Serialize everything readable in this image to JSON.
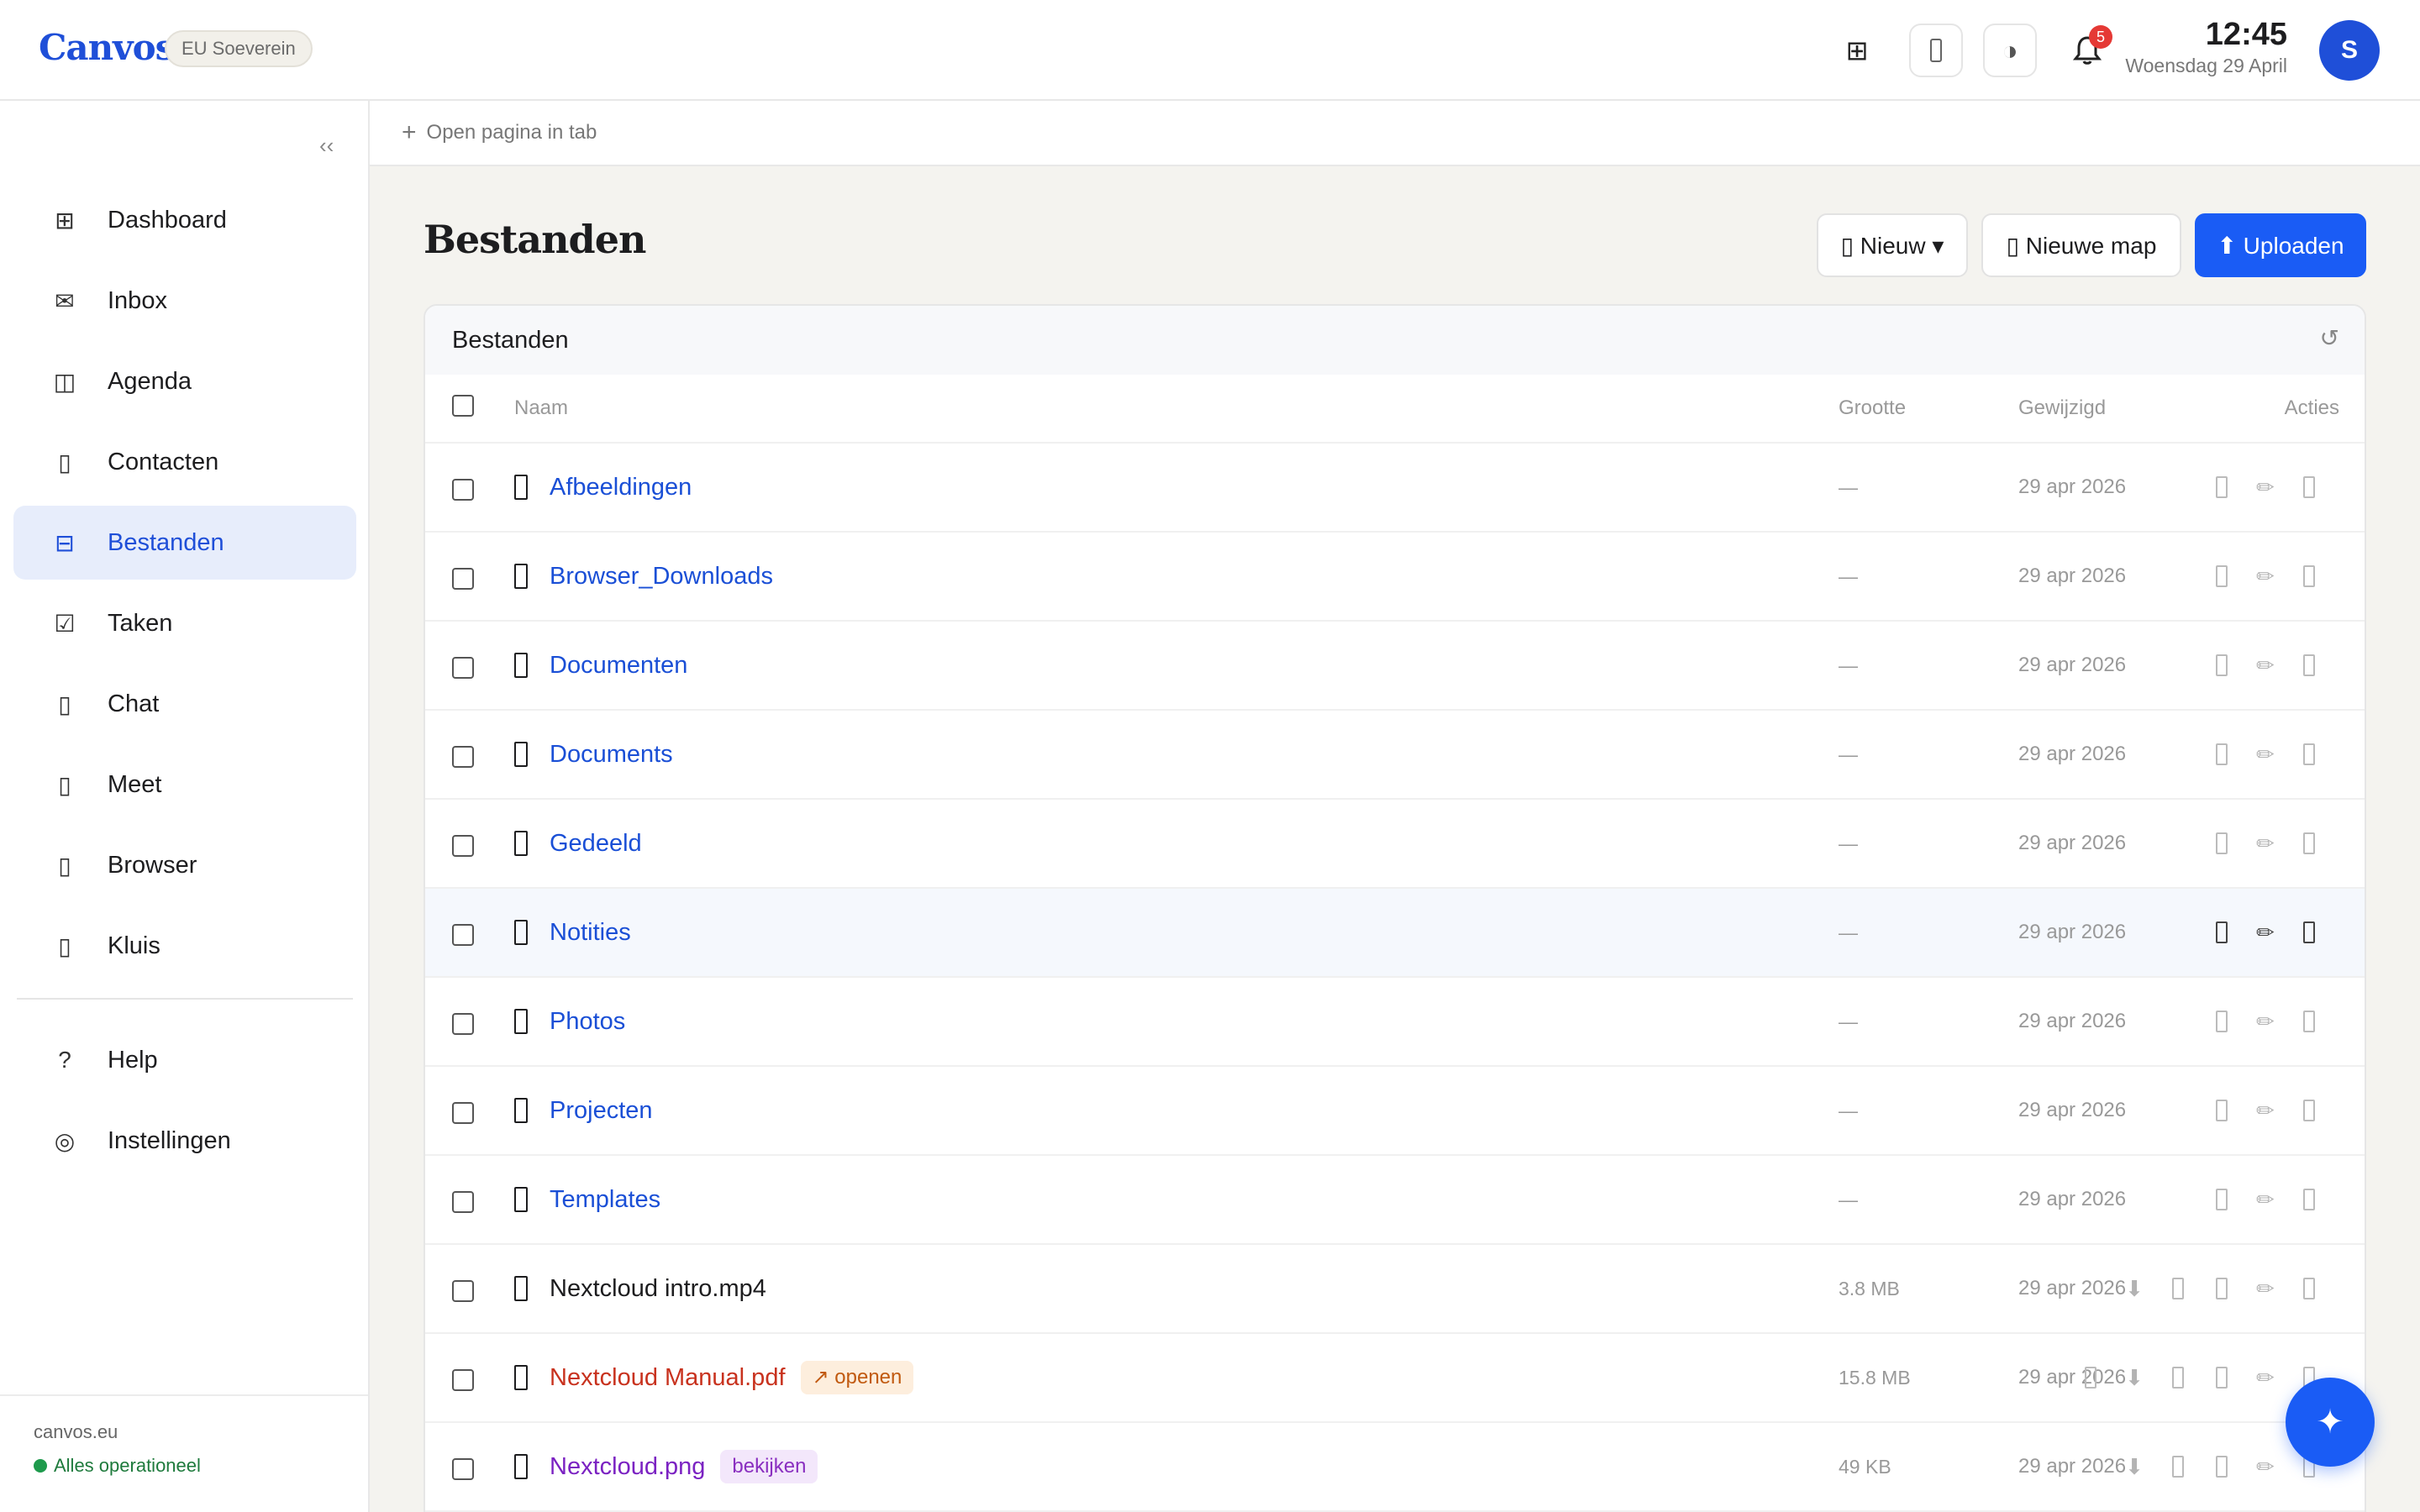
{
  "header": {
    "logo": "Canvos",
    "region_badge": "EU Soeverein",
    "notification_count": "5",
    "clock_time": "12:45",
    "clock_date": "Woensdag 29 April",
    "avatar_initial": "S",
    "icons": [
      "grid-icon",
      "phone-icon",
      "contrast-icon",
      "bell-icon"
    ]
  },
  "sidebar": {
    "collapse_label": "‹‹",
    "items": [
      {
        "label": "Dashboard",
        "icon": "⊞"
      },
      {
        "label": "Inbox",
        "icon": "✉"
      },
      {
        "label": "Agenda",
        "icon": "◫"
      },
      {
        "label": "Contacten",
        "icon": "▯"
      },
      {
        "label": "Bestanden",
        "icon": "⊟",
        "active": true
      },
      {
        "label": "Taken",
        "icon": "☑"
      },
      {
        "label": "Chat",
        "icon": "▯"
      },
      {
        "label": "Meet",
        "icon": "▯"
      },
      {
        "label": "Browser",
        "icon": "▯"
      },
      {
        "label": "Kluis",
        "icon": "▯"
      }
    ],
    "bottom_items": [
      {
        "label": "Help",
        "icon": "?"
      },
      {
        "label": "Instellingen",
        "icon": "◎"
      }
    ],
    "footer_domain": "canvos.eu",
    "footer_status": "Alles operationeel"
  },
  "tabstrip": {
    "open_tab_label": "Open pagina in tab"
  },
  "main": {
    "title": "Bestanden",
    "new_button": "▯ Nieuw ▾",
    "new_folder_button": "▯ Nieuwe map",
    "upload_button": "⬆ Uploaden",
    "panel_title": "Bestanden",
    "columns": {
      "name": "Naam",
      "size": "Grootte",
      "modified": "Gewijzigd",
      "actions": "Acties"
    },
    "rows": [
      {
        "name": "Afbeeldingen",
        "size": "—",
        "modified": "29 apr 2026",
        "kind": "folder"
      },
      {
        "name": "Browser_Downloads",
        "size": "—",
        "modified": "29 apr 2026",
        "kind": "folder"
      },
      {
        "name": "Documenten",
        "size": "—",
        "modified": "29 apr 2026",
        "kind": "folder"
      },
      {
        "name": "Documents",
        "size": "—",
        "modified": "29 apr 2026",
        "kind": "folder"
      },
      {
        "name": "Gedeeld",
        "size": "—",
        "modified": "29 apr 2026",
        "kind": "folder"
      },
      {
        "name": "Notities",
        "size": "—",
        "modified": "29 apr 2026",
        "kind": "folder",
        "hover": true
      },
      {
        "name": "Photos",
        "size": "—",
        "modified": "29 apr 2026",
        "kind": "folder"
      },
      {
        "name": "Projecten",
        "size": "—",
        "modified": "29 apr 2026",
        "kind": "folder"
      },
      {
        "name": "Templates",
        "size": "—",
        "modified": "29 apr 2026",
        "kind": "folder"
      },
      {
        "name": "Nextcloud intro.mp4",
        "size": "3.8 MB",
        "modified": "29 apr 2026",
        "kind": "doc"
      },
      {
        "name": "Nextcloud Manual.pdf",
        "size": "15.8 MB",
        "modified": "29 apr 2026",
        "kind": "pdf",
        "tag": "↗ openen"
      },
      {
        "name": "Nextcloud.png",
        "size": "49 KB",
        "modified": "29 apr 2026",
        "kind": "img",
        "tag": "bekijken"
      }
    ]
  },
  "fab_icon": "✦",
  "colors": {
    "accent": "#1a5cf5",
    "active_nav_bg": "#e7edfb",
    "folder_link": "#1a4fd6",
    "pdf_link": "#c8321e",
    "image_link": "#7b22c2",
    "status_green": "#1e9a4c",
    "notification_red": "#e53935"
  }
}
